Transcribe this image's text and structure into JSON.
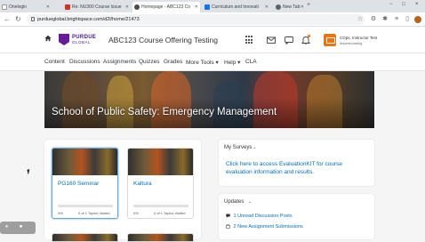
{
  "browser": {
    "tabs": [
      {
        "label": "Onelogin",
        "active": false,
        "color": "#ffffff"
      },
      {
        "label": "Re: NU300 Course Issue",
        "active": false,
        "color": "#d93025"
      },
      {
        "label": "Homepage - ABC123 Co",
        "active": true,
        "color": "#4a4a4a"
      },
      {
        "label": "Curriculum and Innovati",
        "active": false,
        "color": "#1a73e8"
      },
      {
        "label": "New Tab",
        "active": false,
        "color": "#5f6368"
      }
    ],
    "url": "purdueglobal.brightspace.com/d2l/home/21473",
    "window_controls": [
      "−",
      "□",
      "×"
    ]
  },
  "header": {
    "logo_line1": "PURDUE",
    "logo_line2": "GLOBAL",
    "course_title": "ABC123 Course Offering Testing",
    "user_name": "COps, Instructor Test",
    "user_role": "Impersonating",
    "accent_color": "#e87511",
    "icons": [
      "course-selector-icon",
      "message-icon",
      "chat-icon",
      "bell-icon"
    ]
  },
  "nav": {
    "items": [
      "Content",
      "Discussions",
      "Assignments",
      "Quizzes",
      "Grades",
      "More Tools ▾",
      "Help ▾",
      "CLA"
    ]
  },
  "banner": {
    "title": "School of Public Safety: Emergency Management"
  },
  "cards": [
    {
      "title": "PG160 Seminar",
      "progress_fraction": 0.0,
      "percent": "0%",
      "topics": "0 of 1 Topics Visited",
      "selected": true
    },
    {
      "title": "Kaltura",
      "progress_fraction": 0.0,
      "percent": "0%",
      "topics": "0 of 1 Topics Visited",
      "selected": false
    }
  ],
  "surveys": {
    "heading": "My Surveys",
    "link_text": "Click here to access EvaluationKIT for course evaluation information and results."
  },
  "updates": {
    "heading": "Updates",
    "items": [
      {
        "count": "1",
        "label": "Unread Discussion Posts"
      },
      {
        "count": "2",
        "label": "New Assignment Submissions"
      }
    ]
  }
}
